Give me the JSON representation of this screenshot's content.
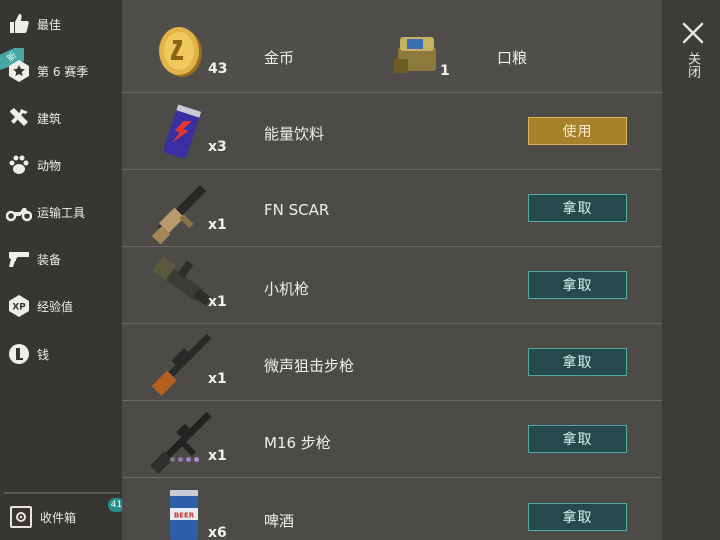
{
  "sidebar": {
    "items": [
      {
        "label": "最佳",
        "icon": "thumbs-up-icon"
      },
      {
        "label": "第 6 赛季",
        "icon": "star-badge-icon"
      },
      {
        "label": "建筑",
        "icon": "tools-icon"
      },
      {
        "label": "动物",
        "icon": "paw-icon"
      },
      {
        "label": "运输工具",
        "icon": "motorcycle-icon"
      },
      {
        "label": "装备",
        "icon": "gun-icon"
      },
      {
        "label": "经验值",
        "icon": "xp-icon"
      },
      {
        "label": "钱",
        "icon": "coin-icon"
      }
    ],
    "season_tag": "新",
    "inbox": {
      "label": "收件箱",
      "badge": "41"
    }
  },
  "rewards": {
    "coin": {
      "qty": "43",
      "name": "金币"
    },
    "ration": {
      "qty": "1",
      "name": "口粮"
    },
    "rows": [
      {
        "qty": "x3",
        "name": "能量饮料",
        "action": "使用"
      },
      {
        "qty": "x1",
        "name": "FN SCAR",
        "action": "拿取"
      },
      {
        "qty": "x1",
        "name": "小机枪",
        "action": "拿取"
      },
      {
        "qty": "x1",
        "name": "微声狙击步枪",
        "action": "拿取"
      },
      {
        "qty": "x1",
        "name": "M16 步枪",
        "action": "拿取"
      },
      {
        "qty": "x6",
        "name": "啤酒",
        "action": "拿取"
      }
    ]
  },
  "close": {
    "label": "关闭"
  },
  "colors": {
    "take_button": "#244a4c",
    "use_button": "#a8812b",
    "accent": "#46a7a4"
  }
}
